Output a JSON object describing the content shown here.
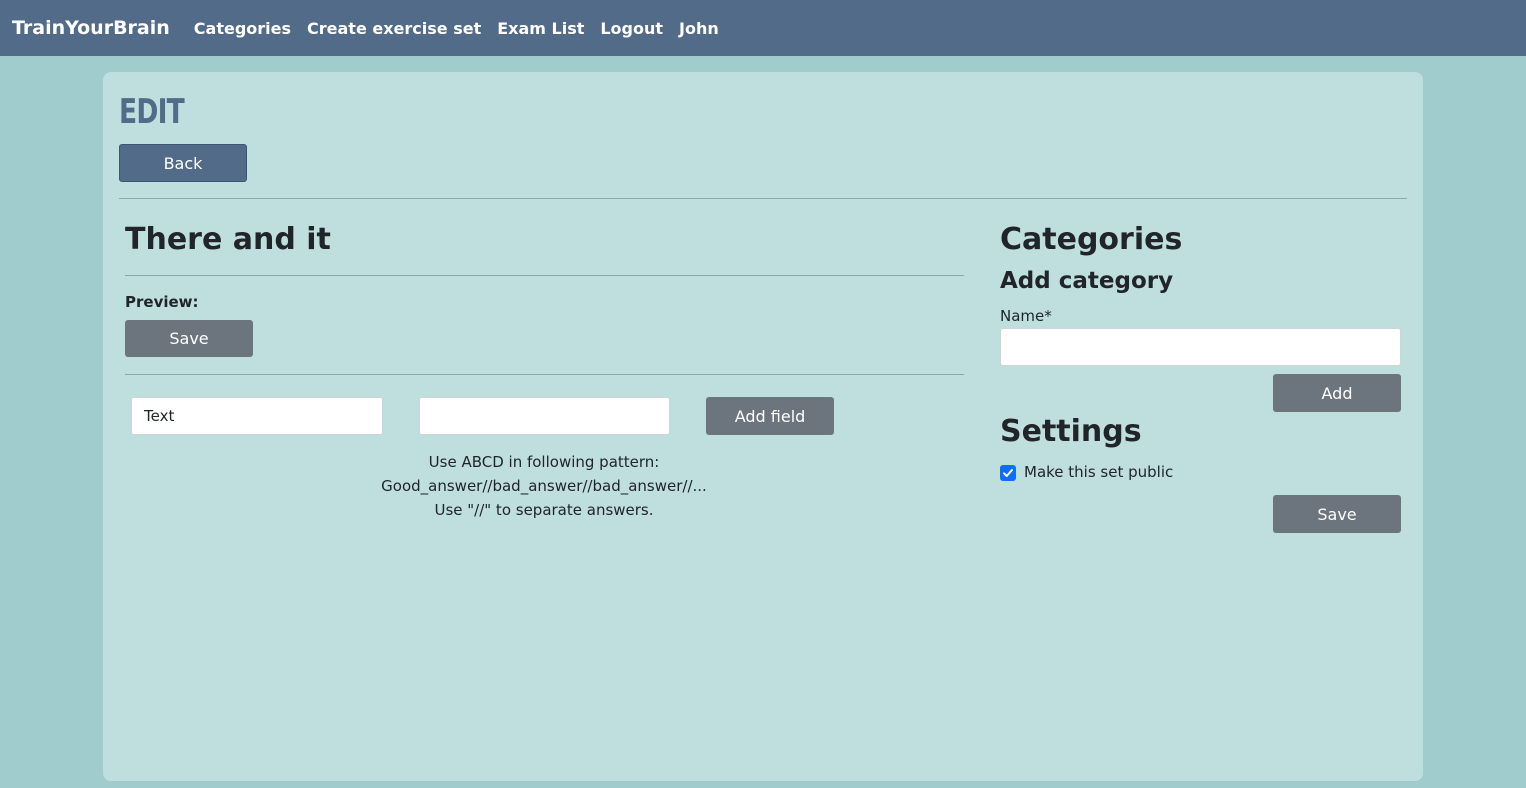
{
  "navbar": {
    "brand": "TrainYourBrain",
    "links": [
      "Categories",
      "Create exercise set",
      "Exam List",
      "Logout",
      "John"
    ]
  },
  "page": {
    "title": "Edit",
    "back_label": "Back"
  },
  "exercise": {
    "title": "There and it",
    "preview_label": "Preview:",
    "save_label": "Save",
    "field_type_value": "Text",
    "field_value": "",
    "add_field_label": "Add field",
    "hint_lines": [
      "Use ABCD in following pattern:",
      "Good_answer//bad_answer//bad_answer//...",
      "Use \"//\" to separate answers."
    ]
  },
  "categories": {
    "title": "Categories",
    "add_title": "Add category",
    "name_label": "Name*",
    "name_value": "",
    "add_label": "Add"
  },
  "settings": {
    "title": "Settings",
    "public_label": "Make this set public",
    "public_checked": true,
    "save_label": "Save"
  },
  "colors": {
    "navbar": "#516b88",
    "background": "#a1cccd",
    "panel": "#bedfde",
    "button_gray": "#6c757d",
    "checkbox": "#0d6efd"
  }
}
